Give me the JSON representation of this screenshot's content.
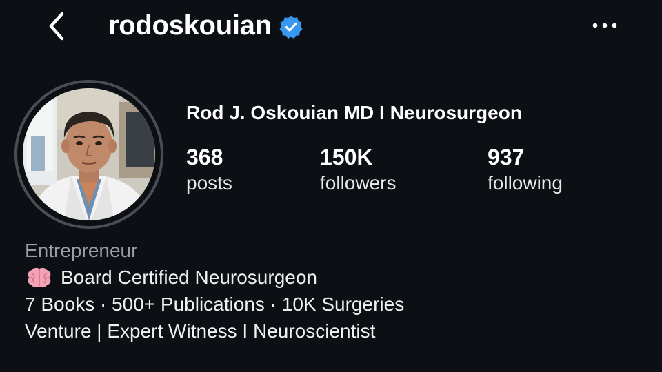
{
  "header": {
    "username": "rodoskouian",
    "verified": true,
    "icons": {
      "back": "chevron-left-icon",
      "verified": "verified-badge-icon",
      "more": "more-horizontal-icon"
    }
  },
  "profile": {
    "display_name": "Rod J. Oskouian MD I Neurosurgeon",
    "avatar": "profile-photo"
  },
  "stats": {
    "posts": {
      "value": "368",
      "label": "posts"
    },
    "followers": {
      "value": "150K",
      "label": "followers"
    },
    "following": {
      "value": "937",
      "label": "following"
    }
  },
  "bio": {
    "category": "Entrepreneur",
    "line1_icon": "brain-emoji-icon",
    "line1": "Board Certified Neurosurgeon",
    "line2": "7 Books · 500+ Publications · 10K Surgeries",
    "line3": "Venture | Expert Witness I Neuroscientist"
  },
  "colors": {
    "background": "#0c0f14",
    "verified_badge": "#3897f0",
    "category_text": "#9a9ea6",
    "avatar_ring": "#4a4d54"
  }
}
